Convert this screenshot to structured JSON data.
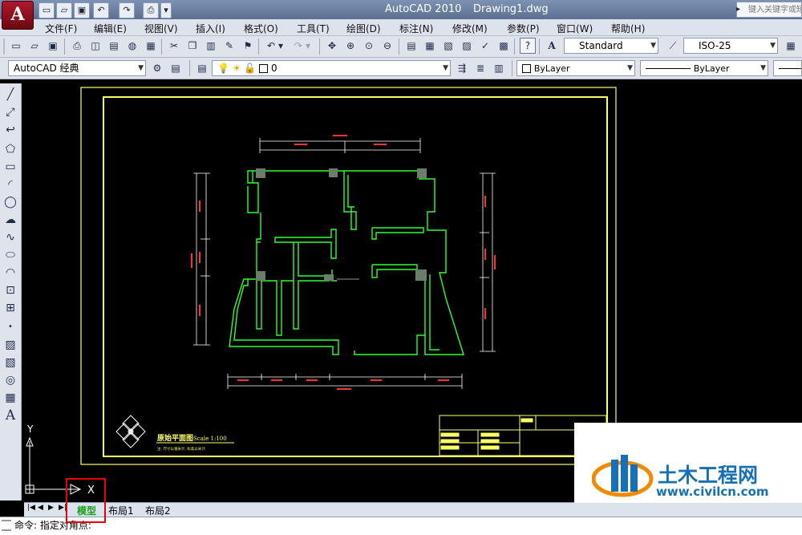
{
  "window": {
    "app_title": "AutoCAD 2010",
    "document_title": "Drawing1.dwg",
    "search_placeholder": "键入关键字或短语",
    "logo_letter": "A"
  },
  "menu": [
    "文件(F)",
    "编辑(E)",
    "视图(V)",
    "插入(I)",
    "格式(O)",
    "工具(T)",
    "绘图(D)",
    "标注(N)",
    "修改(M)",
    "参数(P)",
    "窗口(W)",
    "帮助(H)"
  ],
  "toolbar_styles": {
    "text_style": "Standard",
    "dim_style": "ISO-25"
  },
  "toolbar_layers": {
    "workspace": "AutoCAD 经典",
    "layer": "0",
    "color": "ByLayer",
    "linetype": "ByLayer"
  },
  "drawing": {
    "title_text": "原始平面图",
    "scale_text": "Scale 1:100",
    "note_text": "注: 尺寸以毫米计, 标高以米计.",
    "ucs_y": "Y",
    "ucs_x": "X",
    "colors": {
      "walls": "#2eff2e",
      "frame": "#ffff66",
      "dimensions": "#ff3333",
      "background": "#000000"
    }
  },
  "tabs": {
    "model": "模型",
    "layout1": "布局1",
    "layout2": "布局2"
  },
  "command_line": {
    "text": "命令: 指定对角点:"
  },
  "watermark": {
    "name": "土木工程网",
    "url": "www.civilcn.com"
  }
}
